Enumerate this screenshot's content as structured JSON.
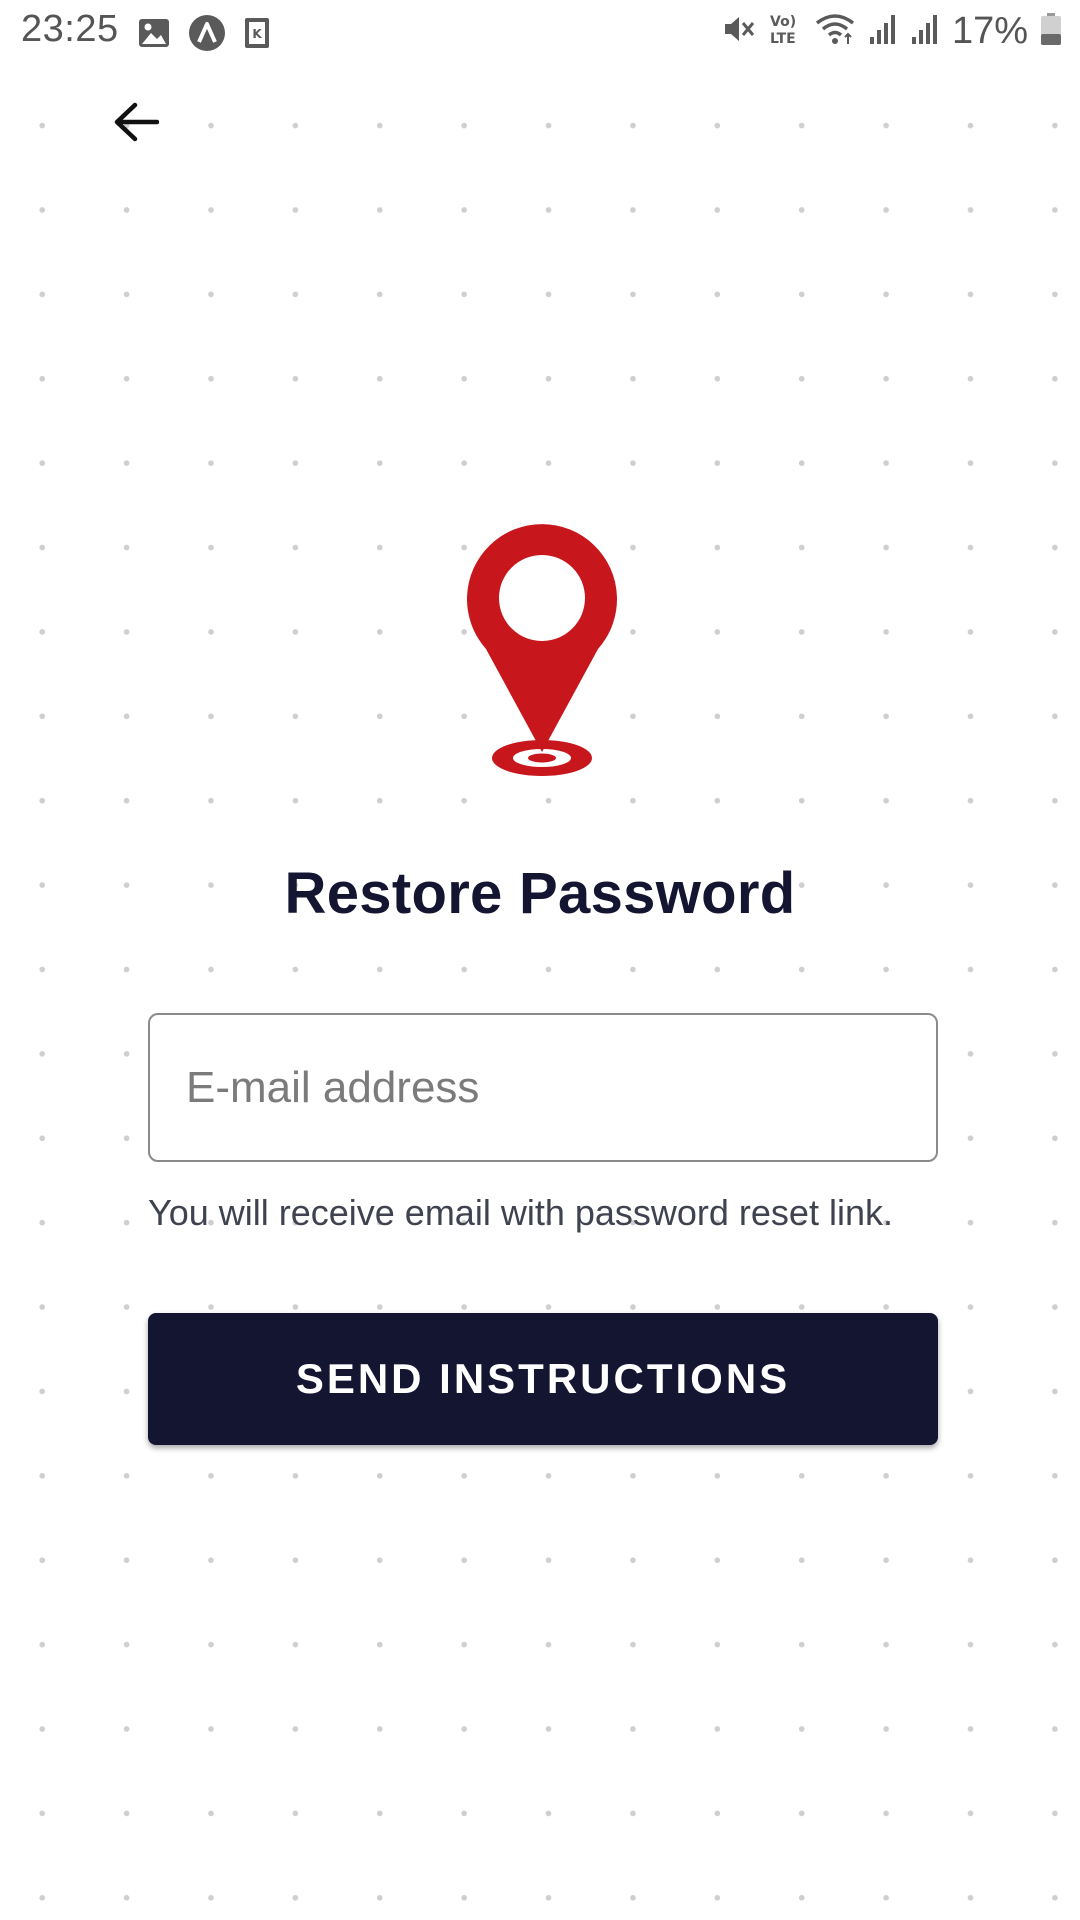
{
  "status_bar": {
    "time": "23:25",
    "battery_percent": "17%",
    "icons_left": [
      "gallery-icon",
      "app-a-icon",
      "app-k-icon"
    ],
    "icons_right": [
      "mute-icon",
      "volte-icon",
      "wifi-icon",
      "signal-icon",
      "signal-icon",
      "battery-icon"
    ]
  },
  "navigation": {
    "back_icon": "arrow-left-icon"
  },
  "logo": {
    "icon": "map-pin-icon",
    "color": "#c8161d"
  },
  "main": {
    "title": "Restore Password",
    "email_placeholder": "E-mail address",
    "email_value": "",
    "hint": "You will receive email with password reset link.",
    "send_button_label": "SEND INSTRUCTIONS"
  },
  "colors": {
    "primary": "#141530",
    "accent": "#c8161d",
    "background": "#ffffff"
  }
}
